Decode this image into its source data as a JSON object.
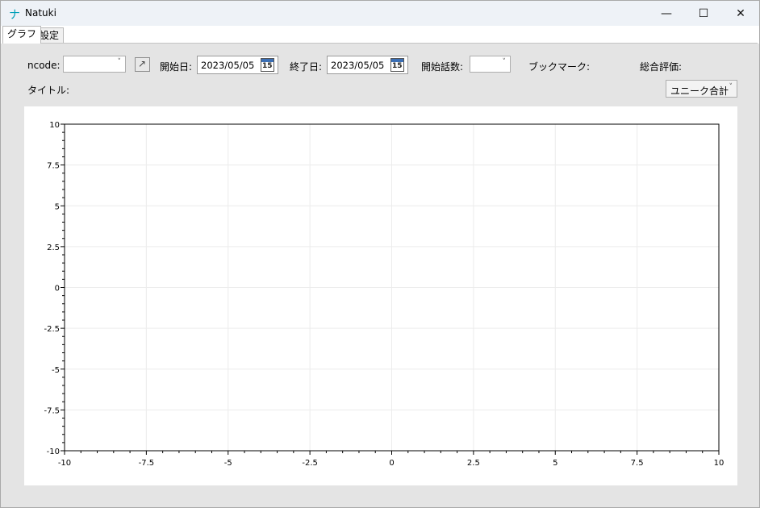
{
  "window": {
    "title": "Natuki",
    "minimize_glyph": "—",
    "maximize_glyph": "☐",
    "close_glyph": "✕",
    "app_icon_glyph": "ナ"
  },
  "tabs": [
    {
      "label": "グラフ",
      "active": true
    },
    {
      "label": "設定",
      "active": false
    }
  ],
  "controls": {
    "ncode_label": "ncode:",
    "ncode_value": "",
    "start_date_label": "開始日:",
    "start_date_value": "2023/05/05",
    "end_date_label": "終了日:",
    "end_date_value": "2023/05/05",
    "start_episode_label": "開始話数:",
    "start_episode_value": "",
    "bookmark_label": "ブックマーク:",
    "total_rating_label": "総合評価:",
    "title_label": "タイトル:",
    "mode_select_value": "ユニーク合計",
    "calendar_day": "15",
    "chevron_glyph": "˅",
    "open_glyph": "↗"
  },
  "chart_data": {
    "type": "line",
    "title": "",
    "xlabel": "",
    "ylabel": "",
    "xlim": [
      -10,
      10
    ],
    "ylim": [
      -10,
      10
    ],
    "xticks": [
      "-10",
      "-7.5",
      "-5",
      "-2.5",
      "0",
      "2.5",
      "5",
      "7.5",
      "10"
    ],
    "yticks": [
      "10",
      "7.5",
      "5",
      "2.5",
      "0",
      "-2.5",
      "-5",
      "-7.5",
      "-10"
    ],
    "grid": true,
    "series": []
  },
  "colors": {
    "accent": "#00a0b8",
    "calendar_header": "#3b6fb5",
    "grid": "#ececec"
  }
}
